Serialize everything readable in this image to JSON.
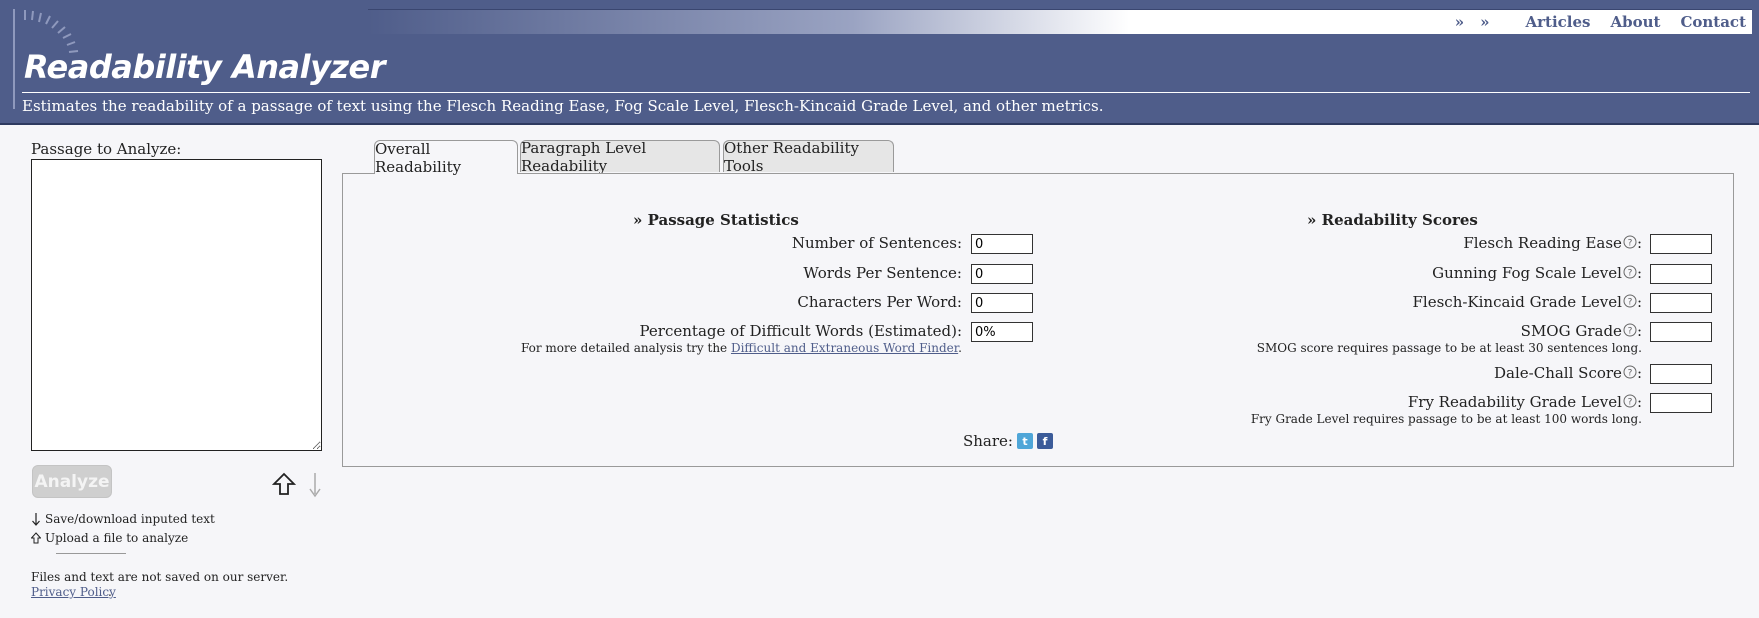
{
  "header": {
    "title": "Readability Analyzer",
    "description": "Estimates the readability of a passage of text using the Flesch Reading Ease, Fog Scale Level, Flesch-Kincaid Grade Level, and other metrics.",
    "nav": {
      "arrow1": "»",
      "arrow2": "»",
      "articles": "Articles",
      "about": "About",
      "contact": "Contact"
    }
  },
  "left": {
    "passage_label": "Passage to Analyze:",
    "passage_value": "",
    "analyze_label": "Analyze",
    "save_text": "Save/download inputed text",
    "upload_text": "Upload a file to analyze",
    "server_note": "Files and text are not saved on our server.",
    "privacy_link": "Privacy Policy",
    "privacy_dot": "."
  },
  "tabs": [
    {
      "label": "Overall Readability",
      "active": true
    },
    {
      "label": "Paragraph Level Readability",
      "active": false
    },
    {
      "label": "Other Readability Tools",
      "active": false
    }
  ],
  "passage_stats": {
    "heading": "» Passage Statistics",
    "rows": [
      {
        "label": "Number of Sentences:",
        "value": "0"
      },
      {
        "label": "Words Per Sentence:",
        "value": "0"
      },
      {
        "label": "Characters Per Word:",
        "value": "0"
      },
      {
        "label": "Percentage of Difficult Words (Estimated):",
        "value": "0%"
      }
    ],
    "note_prefix": "For more detailed analysis try the ",
    "note_link": "Difficult and Extraneous Word Finder",
    "note_suffix": "."
  },
  "scores": {
    "heading": "» Readability Scores",
    "rows": [
      {
        "label": "Flesch Reading Ease",
        "value": ""
      },
      {
        "label": "Gunning Fog Scale Level",
        "value": ""
      },
      {
        "label": "Flesch-Kincaid Grade Level",
        "value": ""
      },
      {
        "label": "SMOG Grade",
        "value": ""
      },
      {
        "label": "Dale-Chall Score",
        "value": ""
      },
      {
        "label": "Fry Readability Grade Level",
        "value": ""
      }
    ],
    "colon": ":",
    "smog_note": "SMOG score requires passage to be at least 30 sentences long.",
    "fry_note": "Fry Grade Level requires passage to be at least 100 words long."
  },
  "share": {
    "label": "Share:",
    "twitter_icon": "twitter-icon",
    "facebook_icon": "facebook-icon"
  },
  "colors": {
    "header_bg": "#4f5d8a",
    "link": "#4f5d8a",
    "page_bg": "#f6f6f9"
  }
}
